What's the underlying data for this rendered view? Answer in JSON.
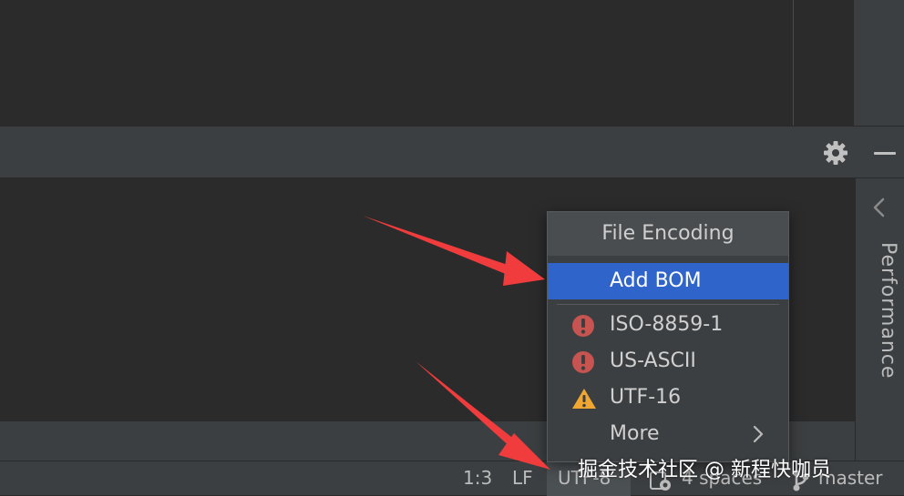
{
  "toolbar": {
    "settings_icon": "gear-icon",
    "minimize_icon": "minimize-icon"
  },
  "side_panel": {
    "label": "Performance",
    "chevron_icon": "chevron-left-icon"
  },
  "popup": {
    "title": "File Encoding",
    "items": [
      {
        "label": "Add BOM",
        "selected": true,
        "icon": ""
      },
      {
        "label": "ISO-8859-1",
        "selected": false,
        "icon": "error-icon"
      },
      {
        "label": "US-ASCII",
        "selected": false,
        "icon": "error-icon"
      },
      {
        "label": "UTF-16",
        "selected": false,
        "icon": "warning-icon"
      },
      {
        "label": "More",
        "selected": false,
        "icon": "chevron-right-icon"
      }
    ]
  },
  "status_bar": {
    "position": "1:3",
    "line_separator": "LF",
    "encoding": "UTF-8",
    "indent": "4 spaces",
    "branch": "master"
  },
  "watermark": "掘金技术社区 @ 新程快咖员",
  "colors": {
    "background": "#2b2b2b",
    "panel": "#3c3f41",
    "selection": "#2f65ca",
    "error": "#c75450",
    "warning": "#f0a732",
    "arrow": "#f03c3c"
  }
}
